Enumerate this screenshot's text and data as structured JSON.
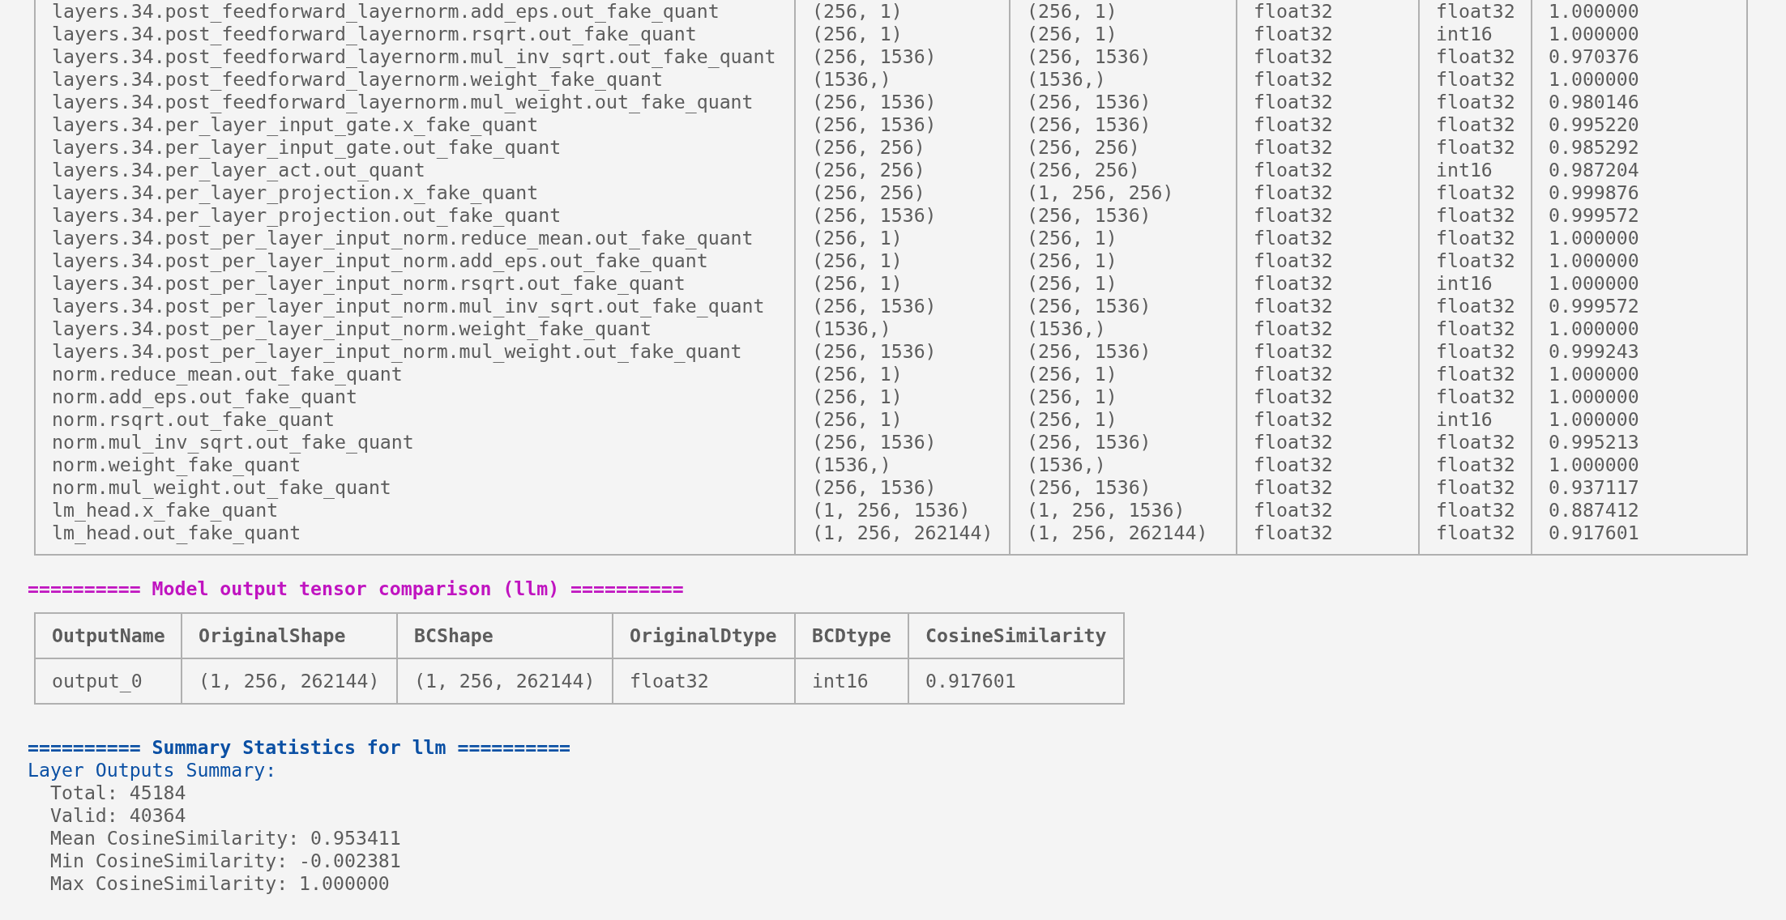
{
  "layer_table": {
    "rows": [
      [
        "layers.34.post_feedforward_layernorm.add_eps.out_fake_quant",
        "(256, 1)",
        "(256, 1)",
        "float32",
        "float32",
        "1.000000"
      ],
      [
        "layers.34.post_feedforward_layernorm.rsqrt.out_fake_quant",
        "(256, 1)",
        "(256, 1)",
        "float32",
        "int16",
        "1.000000"
      ],
      [
        "layers.34.post_feedforward_layernorm.mul_inv_sqrt.out_fake_quant",
        "(256, 1536)",
        "(256, 1536)",
        "float32",
        "float32",
        "0.970376"
      ],
      [
        "layers.34.post_feedforward_layernorm.weight_fake_quant",
        "(1536,)",
        "(1536,)",
        "float32",
        "float32",
        "1.000000"
      ],
      [
        "layers.34.post_feedforward_layernorm.mul_weight.out_fake_quant",
        "(256, 1536)",
        "(256, 1536)",
        "float32",
        "float32",
        "0.980146"
      ],
      [
        "layers.34.per_layer_input_gate.x_fake_quant",
        "(256, 1536)",
        "(256, 1536)",
        "float32",
        "float32",
        "0.995220"
      ],
      [
        "layers.34.per_layer_input_gate.out_fake_quant",
        "(256, 256)",
        "(256, 256)",
        "float32",
        "float32",
        "0.985292"
      ],
      [
        "layers.34.per_layer_act.out_quant",
        "(256, 256)",
        "(256, 256)",
        "float32",
        "int16",
        "0.987204"
      ],
      [
        "layers.34.per_layer_projection.x_fake_quant",
        "(256, 256)",
        "(1, 256, 256)",
        "float32",
        "float32",
        "0.999876"
      ],
      [
        "layers.34.per_layer_projection.out_fake_quant",
        "(256, 1536)",
        "(256, 1536)",
        "float32",
        "float32",
        "0.999572"
      ],
      [
        "layers.34.post_per_layer_input_norm.reduce_mean.out_fake_quant",
        "(256, 1)",
        "(256, 1)",
        "float32",
        "float32",
        "1.000000"
      ],
      [
        "layers.34.post_per_layer_input_norm.add_eps.out_fake_quant",
        "(256, 1)",
        "(256, 1)",
        "float32",
        "float32",
        "1.000000"
      ],
      [
        "layers.34.post_per_layer_input_norm.rsqrt.out_fake_quant",
        "(256, 1)",
        "(256, 1)",
        "float32",
        "int16",
        "1.000000"
      ],
      [
        "layers.34.post_per_layer_input_norm.mul_inv_sqrt.out_fake_quant",
        "(256, 1536)",
        "(256, 1536)",
        "float32",
        "float32",
        "0.999572"
      ],
      [
        "layers.34.post_per_layer_input_norm.weight_fake_quant",
        "(1536,)",
        "(1536,)",
        "float32",
        "float32",
        "1.000000"
      ],
      [
        "layers.34.post_per_layer_input_norm.mul_weight.out_fake_quant",
        "(256, 1536)",
        "(256, 1536)",
        "float32",
        "float32",
        "0.999243"
      ],
      [
        "norm.reduce_mean.out_fake_quant",
        "(256, 1)",
        "(256, 1)",
        "float32",
        "float32",
        "1.000000"
      ],
      [
        "norm.add_eps.out_fake_quant",
        "(256, 1)",
        "(256, 1)",
        "float32",
        "float32",
        "1.000000"
      ],
      [
        "norm.rsqrt.out_fake_quant",
        "(256, 1)",
        "(256, 1)",
        "float32",
        "int16",
        "1.000000"
      ],
      [
        "norm.mul_inv_sqrt.out_fake_quant",
        "(256, 1536)",
        "(256, 1536)",
        "float32",
        "float32",
        "0.995213"
      ],
      [
        "norm.weight_fake_quant",
        "(1536,)",
        "(1536,)",
        "float32",
        "float32",
        "1.000000"
      ],
      [
        "norm.mul_weight.out_fake_quant",
        "(256, 1536)",
        "(256, 1536)",
        "float32",
        "float32",
        "0.937117"
      ],
      [
        "lm_head.x_fake_quant",
        "(1, 256, 1536)",
        "(1, 256, 1536)",
        "float32",
        "float32",
        "0.887412"
      ],
      [
        "lm_head.out_fake_quant",
        "(1, 256, 262144)",
        "(1, 256, 262144)",
        "float32",
        "float32",
        "0.917601"
      ]
    ]
  },
  "output_comparison": {
    "title": "========== Model output tensor comparison (llm) ==========",
    "table": {
      "columns": [
        "OutputName",
        "OriginalShape",
        "BCShape",
        "OriginalDtype",
        "BCDtype",
        "CosineSimilarity"
      ],
      "rows": [
        [
          "output_0",
          "(1, 256, 262144)",
          "(1, 256, 262144)",
          "float32",
          "int16",
          "0.917601"
        ]
      ]
    }
  },
  "summary": {
    "title": "========== Summary Statistics for llm ==========",
    "heading": "Layer Outputs Summary:",
    "lines": [
      "Total: 45184",
      "Valid: 40364",
      "Mean CosineSimilarity: 0.953411",
      "Min CosineSimilarity: -0.002381",
      "Max CosineSimilarity: 1.000000"
    ]
  }
}
